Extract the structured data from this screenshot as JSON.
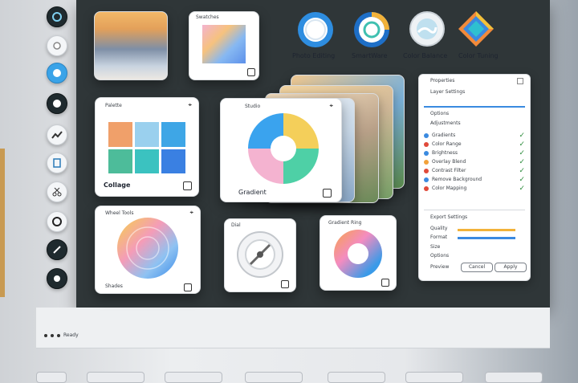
{
  "apps": [
    {
      "label": "Photo Editing",
      "icon": "blue-ring-icon"
    },
    {
      "label": "SmartWare",
      "icon": "teal-ring-icon"
    },
    {
      "label": "Color Balance",
      "icon": "wave-ring-icon"
    },
    {
      "label": "Color Tuning",
      "icon": "diamond-icon"
    }
  ],
  "cards": {
    "palette_card": {
      "title": "Palette",
      "footer": "Collage"
    },
    "pie_card": {
      "title": "Studio",
      "footer": "Gradient"
    },
    "wheel_card": {
      "title": "Wheel Tools",
      "footer": "Shades"
    },
    "dial_card": {
      "title": "Dial"
    },
    "ring_card": {
      "title": "Gradient Ring"
    },
    "swatch_card": {
      "title": "Swatches"
    }
  },
  "panel": {
    "title": "Properties",
    "subtitle": "Layer Settings",
    "section_label": "Options",
    "sub_label": "Adjustments",
    "items": [
      "Gradients",
      "Color Range",
      "Brightness",
      "Overlay Blend",
      "Contrast Filter",
      "Remove Background",
      "Color Mapping"
    ],
    "footer_section": "Export Settings",
    "field_quality": "Quality",
    "field_format": "Format",
    "field_size": "Size",
    "option_label": "Options",
    "cancel_label": "Cancel",
    "apply_label": "Apply",
    "option_item": "Preview"
  },
  "statusbar": {
    "text": "Ready"
  },
  "colors": {
    "accent": "#3aa3e8",
    "dark_panel": "#2f3638"
  }
}
